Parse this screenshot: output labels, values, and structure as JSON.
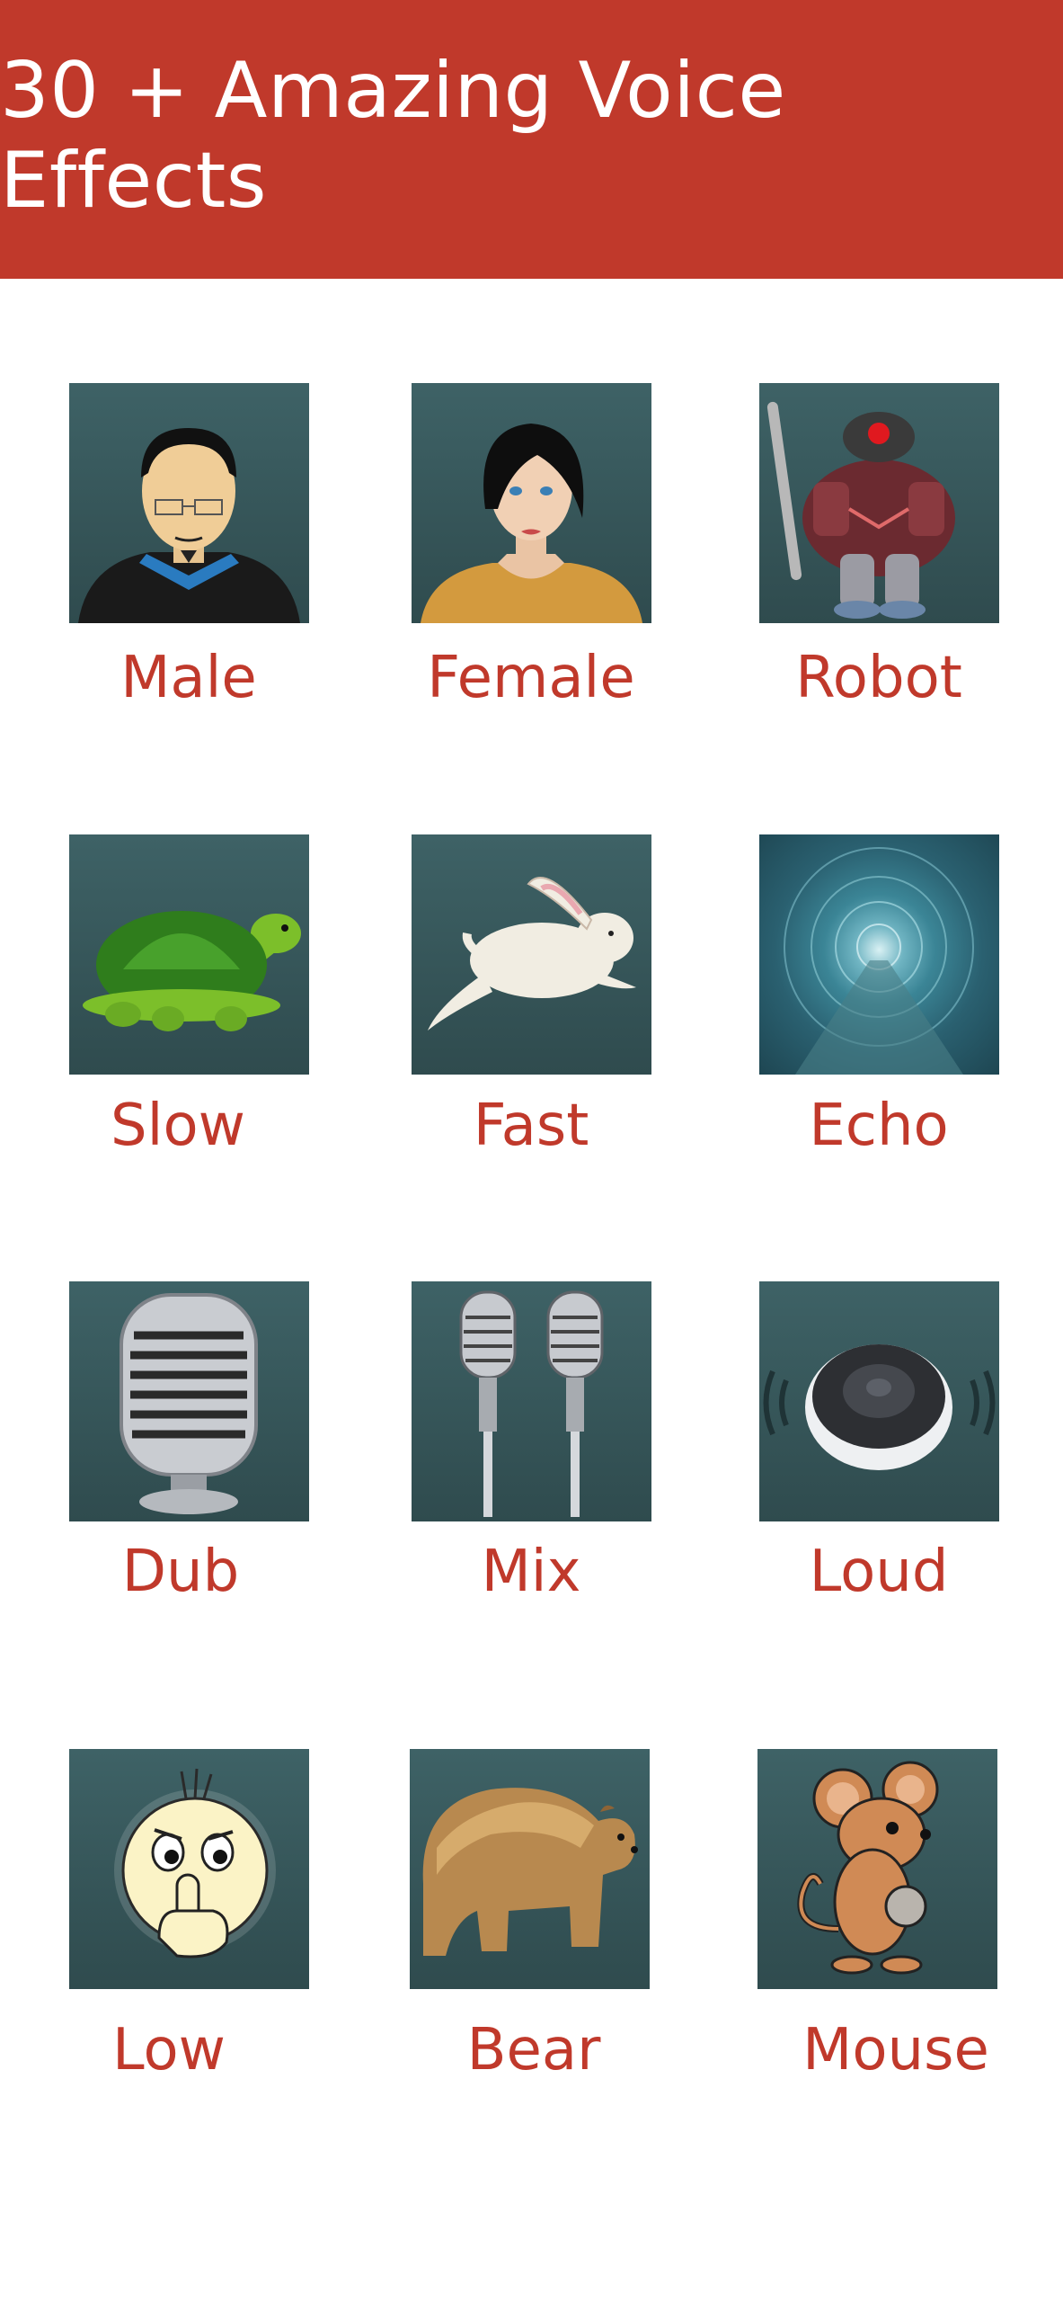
{
  "header": {
    "title": "30 + Amazing Voice Effects"
  },
  "effects": [
    {
      "label": "Male",
      "icon": "male-face-icon"
    },
    {
      "label": "Female",
      "icon": "female-face-icon"
    },
    {
      "label": "Robot",
      "icon": "robot-icon"
    },
    {
      "label": "Slow",
      "icon": "turtle-icon"
    },
    {
      "label": "Fast",
      "icon": "rabbit-icon"
    },
    {
      "label": "Echo",
      "icon": "tunnel-icon"
    },
    {
      "label": "Dub",
      "icon": "microphone-icon"
    },
    {
      "label": "Mix",
      "icon": "double-microphone-icon"
    },
    {
      "label": "Loud",
      "icon": "speaker-icon"
    },
    {
      "label": "Low",
      "icon": "shush-face-icon"
    },
    {
      "label": "Bear",
      "icon": "bear-icon"
    },
    {
      "label": "Mouse",
      "icon": "mouse-icon"
    }
  ],
  "colors": {
    "accent": "#c0392b",
    "tile_top": "#3e6266",
    "tile_bottom": "#2f4b4e",
    "background": "#ffffff"
  }
}
